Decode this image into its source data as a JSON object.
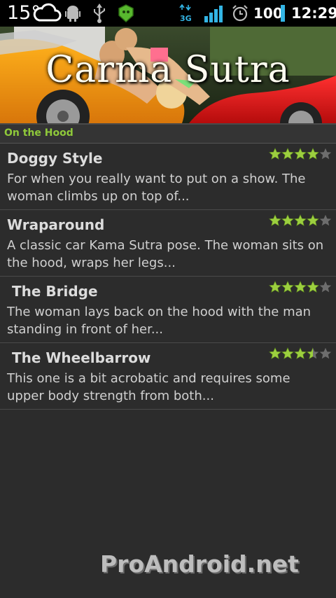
{
  "status_bar": {
    "temperature": "15°",
    "network_type": "3G",
    "battery_level": "100",
    "time": "12:29",
    "icons": [
      "cloud-icon",
      "android-debug-icon",
      "usb-icon",
      "app-notification-icon",
      "network-3g-icon",
      "signal-icon",
      "alarm-icon",
      "battery-icon"
    ]
  },
  "banner": {
    "title": "Carma Sutra"
  },
  "section": {
    "header": "On the Hood"
  },
  "items": [
    {
      "title": "Doggy Style",
      "description": "For when you really want to put on a show. The woman climbs up on top of...",
      "rating": 4
    },
    {
      "title": "Wraparound",
      "description": "A classic car Kama Sutra pose. The woman sits on the hood, wraps her legs...",
      "rating": 4
    },
    {
      "title": " The Bridge",
      "description": "The woman lays back on the hood with the man standing in front of her...",
      "rating": 4
    },
    {
      "title": " The Wheelbarrow",
      "description": "This one is a bit acrobatic and requires some upper body strength from both...",
      "rating": 3.5
    }
  ],
  "rating_max": 5,
  "watermark": "ProAndroid.net",
  "colors": {
    "accent_green": "#8fc93a",
    "star_filled": "#9ccf3f",
    "star_empty": "#6d6d6d",
    "battery_blue": "#33b5e5"
  }
}
